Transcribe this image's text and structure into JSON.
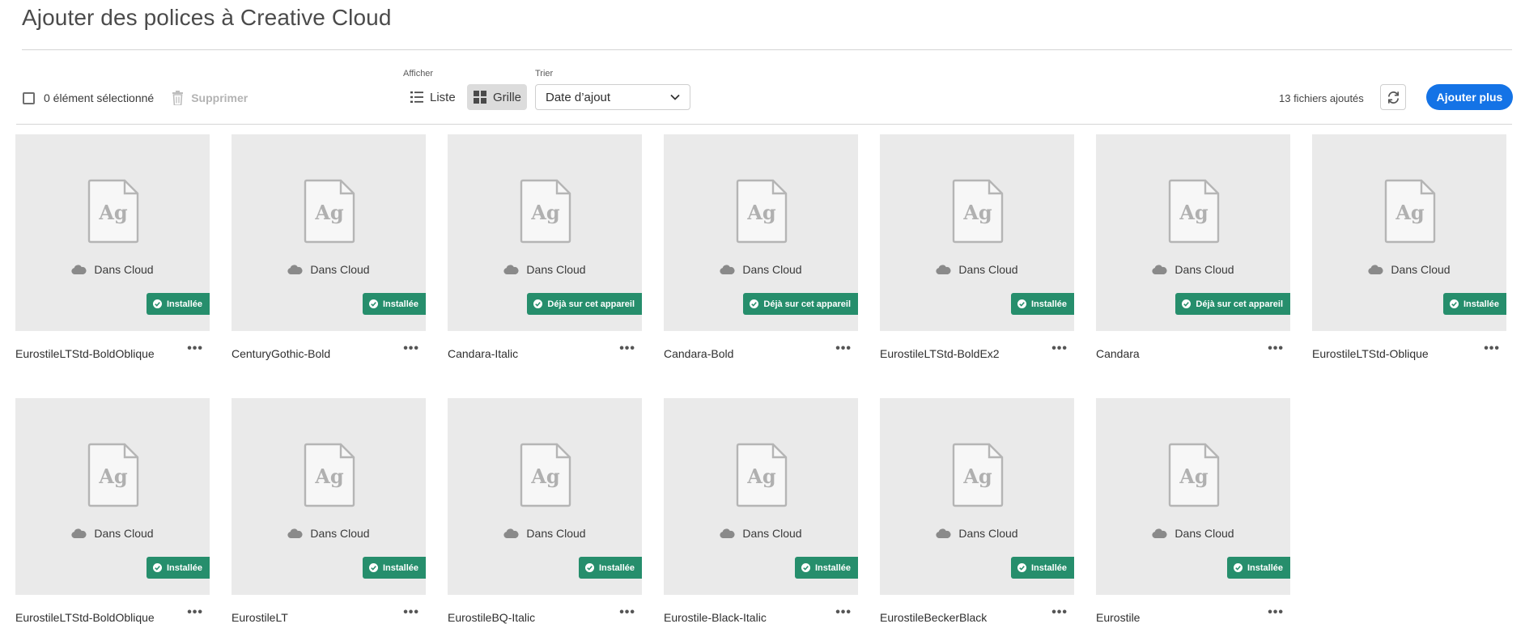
{
  "page": {
    "title": "Ajouter des polices à Creative Cloud"
  },
  "toolbar": {
    "selection_label": "0 élément sélectionné",
    "delete_label": "Supprimer",
    "view_group_label": "Afficher",
    "view_list_label": "Liste",
    "view_grid_label": "Grille",
    "view_selected": "Grille",
    "sort_group_label": "Trier",
    "sort_value": "Date d’ajout",
    "count_label": "13 fichiers ajoutés",
    "add_more_label": "Ajouter plus"
  },
  "colors": {
    "accent": "#1473e6",
    "badge_green": "#268e6c",
    "card_bg": "#eaeaea"
  },
  "fonts": [
    {
      "name": "EurostileLTStd-BoldOblique",
      "status": "Dans Cloud",
      "badge": "Installée"
    },
    {
      "name": "CenturyGothic-Bold",
      "status": "Dans Cloud",
      "badge": "Installée"
    },
    {
      "name": "Candara-Italic",
      "status": "Dans Cloud",
      "badge": "Déjà sur cet appareil"
    },
    {
      "name": "Candara-Bold",
      "status": "Dans Cloud",
      "badge": "Déjà sur cet appareil"
    },
    {
      "name": "EurostileLTStd-BoldEx2",
      "status": "Dans Cloud",
      "badge": "Installée"
    },
    {
      "name": "Candara",
      "status": "Dans Cloud",
      "badge": "Déjà sur cet appareil"
    },
    {
      "name": "EurostileLTStd-Oblique",
      "status": "Dans Cloud",
      "badge": "Installée"
    },
    {
      "name": "EurostileLTStd-BoldOblique",
      "status": "Dans Cloud",
      "badge": "Installée"
    },
    {
      "name": "EurostileLT",
      "status": "Dans Cloud",
      "badge": "Installée"
    },
    {
      "name": "EurostileBQ-Italic",
      "status": "Dans Cloud",
      "badge": "Installée"
    },
    {
      "name": "Eurostile-Black-Italic",
      "status": "Dans Cloud",
      "badge": "Installée"
    },
    {
      "name": "EurostileBeckerBlack",
      "status": "Dans Cloud",
      "badge": "Installée"
    },
    {
      "name": "Eurostile",
      "status": "Dans Cloud",
      "badge": "Installée"
    }
  ],
  "preview_glyph": "Ag",
  "more_label": "•••"
}
